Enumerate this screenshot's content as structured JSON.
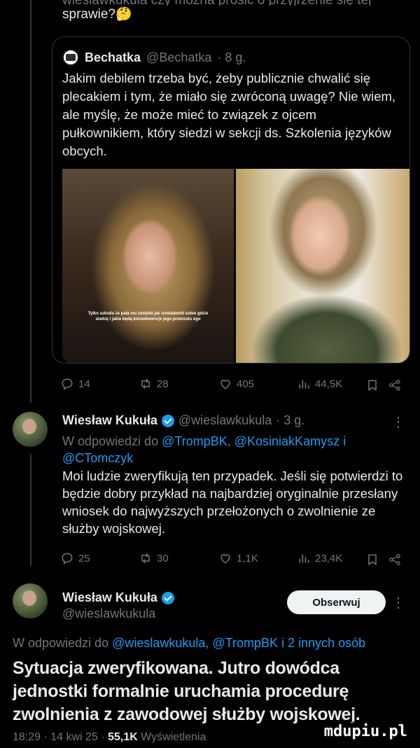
{
  "top_post": {
    "partial_line": "wieslawkukula czy można prosić o przyjrzenie się tej",
    "text_end": "sprawie?🤔"
  },
  "quoted_post": {
    "author_name": "Bechatka",
    "handle": "@Bechatka",
    "time": "· 8 g.",
    "body": "Jakim debilem trzeba być, żeby publicznie chwalić się plecakiem i tym, że miało się zwróconą uwagę? Nie wiem, ale myślę, że może mieć to związek z ojcem pułkownikiem, który siedzi w sekcji ds. Szkolenia języków obcych.",
    "image_caption": "Tylko szkoda że pała mu zmiękła jak uświadomił sobie gdzie siedzę i jakie będą konsekwencje jego przerostu ego"
  },
  "quoted_actions": {
    "replies": "14",
    "reposts": "28",
    "likes": "405",
    "views": "44,5K"
  },
  "reply1": {
    "author_name": "Wiesław Kukuła",
    "handle": "@wieslawkukula",
    "time": "· 3 g.",
    "replying_prefix": "W odpowiedzi do",
    "mentions": [
      "@TrompBK",
      "@KosiniakKamysz",
      "i",
      "@CTomczyk"
    ],
    "body": "Moi ludzie zweryfikują ten przypadek. Jeśli się potwierdzi to będzie dobry przykład na najbardziej oryginalnie przesłany wniosek do najwyższych przełożonych o zwolnienie ze służby wojskowej.",
    "actions": {
      "replies": "25",
      "reposts": "30",
      "likes": "1,1K",
      "views": "23,4K"
    },
    "more": "⋮"
  },
  "main_post": {
    "author_name": "Wiesław Kukuła",
    "handle": "@wieslawkukula",
    "follow_label": "Obserwuj",
    "more": "⋮",
    "reply_line_prefix": "W odpowiedzi do",
    "reply_line_mentions": "@wieslawkukula, @TrompBK",
    "reply_line_suffix": "i 2 innych osób",
    "body": "Sytuacja zweryfikowana. Jutro dowódca jednostki formalnie uruchamia procedurę zwolnienia z zawodowej służby wojskowej.",
    "time": "18:29 · 14 kwi 25 ·",
    "views_count": "55,1K",
    "views_label": "Wyświetlenia"
  },
  "watermark": "mdupiu.pl",
  "colors": {
    "background": "#000000",
    "text": "#e7e9ea",
    "muted": "#71767b",
    "link": "#1d9bf0",
    "border": "#2f3336"
  }
}
